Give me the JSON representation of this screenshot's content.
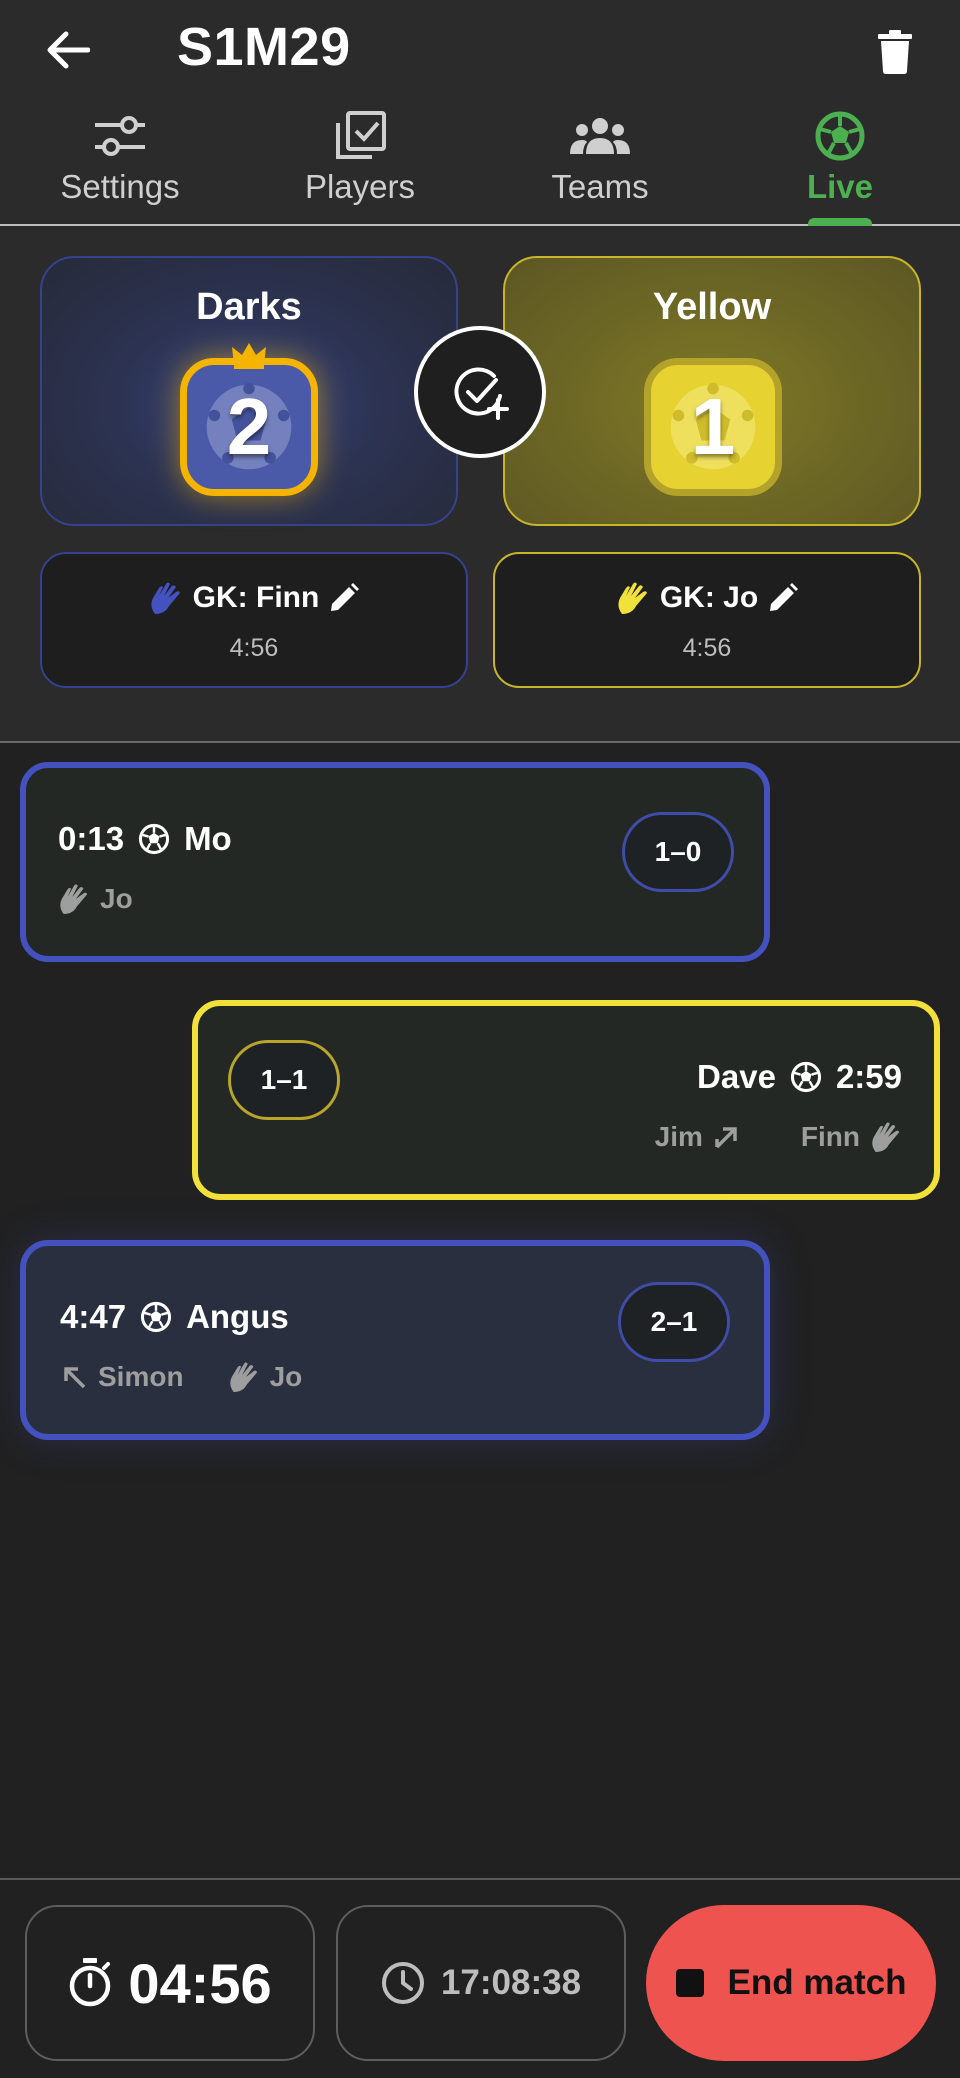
{
  "header": {
    "title": "S1M29"
  },
  "tabs": [
    {
      "label": "Settings",
      "icon": "sliders-icon"
    },
    {
      "label": "Players",
      "icon": "checklist-icon"
    },
    {
      "label": "Teams",
      "icon": "group-icon"
    },
    {
      "label": "Live",
      "icon": "soccer-ball-icon",
      "active": true
    }
  ],
  "colors": {
    "accent": "#4caf50",
    "dark_team": "#4452c0",
    "yellow_team": "#f2e13a",
    "end_button": "#ef5350",
    "crown": "#f5b400"
  },
  "teams": {
    "dark": {
      "name": "Darks",
      "score": "2",
      "leader": true,
      "gk_label": "GK: Finn",
      "gk_time": "4:56"
    },
    "yellow": {
      "name": "Yellow",
      "score": "1",
      "leader": false,
      "gk_label": "GK: Jo",
      "gk_time": "4:56"
    }
  },
  "events": [
    {
      "team": "dark",
      "time": "0:13",
      "scorer": "Mo",
      "assist": "",
      "keeper": "Jo",
      "score": "1–0"
    },
    {
      "team": "yellow",
      "time": "2:59",
      "scorer": "Dave",
      "assist": "Jim",
      "keeper": "Finn",
      "score": "1–1"
    },
    {
      "team": "dark",
      "time": "4:47",
      "scorer": "Angus",
      "assist": "Simon",
      "keeper": "Jo",
      "score": "2–1"
    }
  ],
  "footer": {
    "match_timer": "04:56",
    "clock": "17:08:38",
    "end_label": "End match"
  }
}
